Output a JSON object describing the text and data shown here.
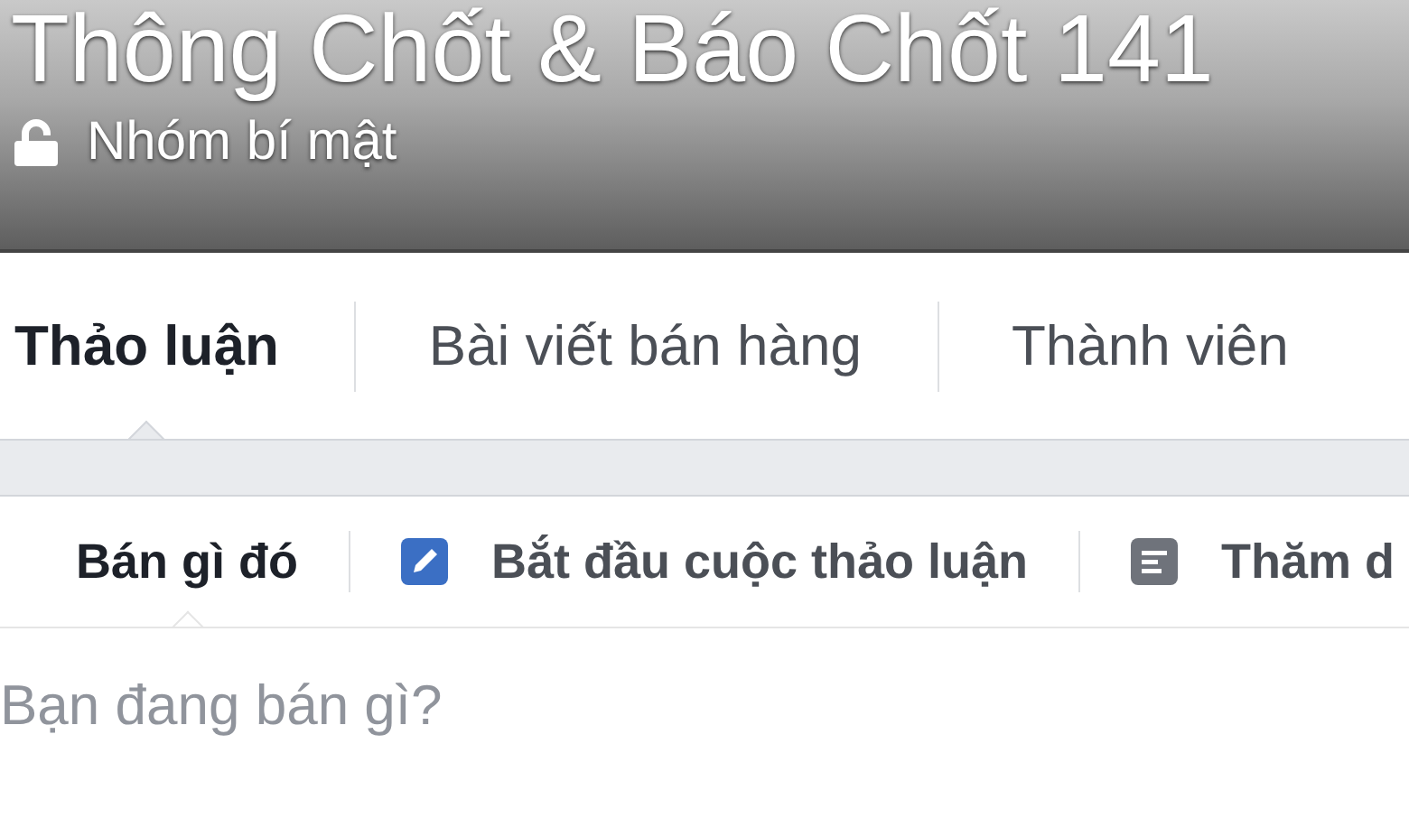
{
  "header": {
    "title": "Thông Chốt & Báo Chốt 141",
    "privacy": "Nhóm bí mật"
  },
  "tabs": [
    {
      "label": "Thảo luận",
      "selected": true
    },
    {
      "label": "Bài viết bán hàng",
      "selected": false
    },
    {
      "label": "Thành viên",
      "selected": false
    }
  ],
  "composer": {
    "actions": [
      {
        "kind": "sell",
        "label": "Bán gì đó",
        "selected": true
      },
      {
        "kind": "discussion",
        "label": "Bắt đầu cuộc thảo luận",
        "selected": false
      },
      {
        "kind": "poll",
        "label": "Thăm d",
        "selected": false
      }
    ],
    "input": {
      "placeholder": "Bạn đang bán gì?"
    }
  }
}
